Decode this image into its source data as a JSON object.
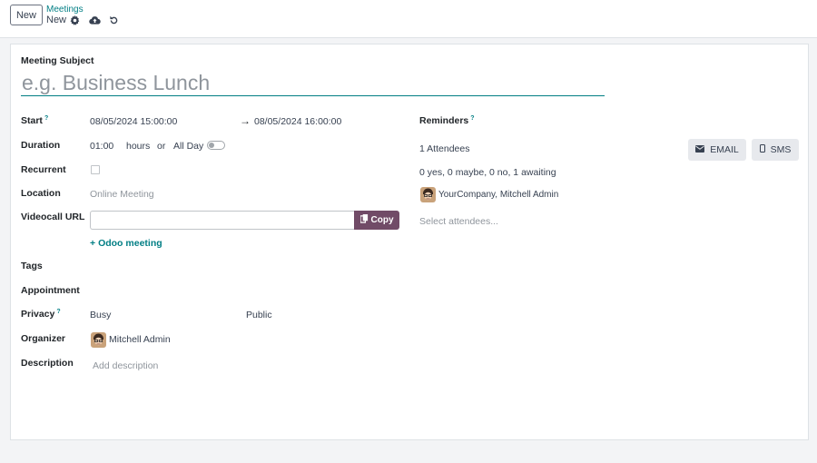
{
  "toolbar": {
    "new_label": "New",
    "breadcrumb_parent": "Meetings",
    "breadcrumb_current": "New"
  },
  "form": {
    "subject_label": "Meeting Subject",
    "subject_placeholder": "e.g. Business Lunch",
    "start_label": "Start",
    "start_help": "?",
    "start_value": "08/05/2024 15:00:00",
    "stop_value": "08/05/2024 16:00:00",
    "duration_label": "Duration",
    "duration_value": "01:00",
    "duration_unit": "hours",
    "or_text": "or",
    "allday_label": "All Day",
    "recurrent_label": "Recurrent",
    "location_label": "Location",
    "location_value": "Online Meeting",
    "videocall_label": "Videocall URL",
    "copy_label": "Copy",
    "odoo_meeting_label": "Odoo meeting",
    "tags_label": "Tags",
    "appointment_label": "Appointment",
    "privacy_label": "Privacy",
    "privacy_help": "?",
    "privacy_show_as": "Busy",
    "privacy_value": "Public",
    "organizer_label": "Organizer",
    "organizer_value": "Mitchell Admin",
    "description_label": "Description",
    "description_placeholder": "Add description"
  },
  "attendees": {
    "reminders_label": "Reminders",
    "reminders_help": "?",
    "count_text": "1 Attendees",
    "email_label": "EMAIL",
    "sms_label": "SMS",
    "status_text": "0 yes, 0 maybe, 0 no, 1 awaiting",
    "attendee_name": "YourCompany, Mitchell Admin",
    "select_placeholder": "Select attendees..."
  },
  "colors": {
    "accent": "#017e84",
    "brand": "#714b67"
  }
}
